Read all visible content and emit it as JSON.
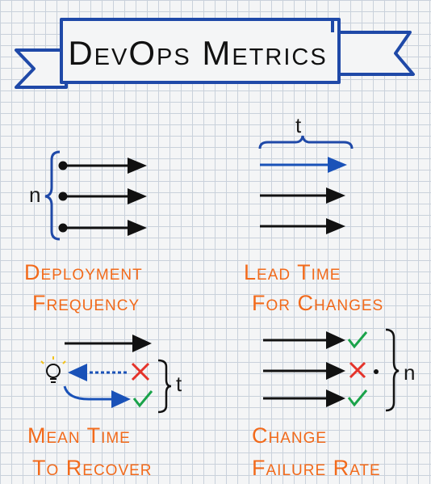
{
  "title": "DevOps Metrics",
  "colors": {
    "banner": "#1f49a8",
    "ink": "#111111",
    "label": "#f26a1b",
    "fail": "#e5332a",
    "success": "#1aa34a",
    "blue": "#1a52b8"
  },
  "quadrants": [
    {
      "id": "deployment-frequency",
      "line1": "Deployment",
      "line2": "Frequency",
      "marker": "n"
    },
    {
      "id": "lead-time",
      "line1": "Lead Time",
      "line2": "For Changes",
      "marker": "t"
    },
    {
      "id": "mean-time-to-recover",
      "line1": "Mean Time",
      "line2": "To Recover",
      "marker": "t"
    },
    {
      "id": "change-failure-rate",
      "line1": "Change",
      "line2": "Failure Rate",
      "marker": "n"
    }
  ]
}
